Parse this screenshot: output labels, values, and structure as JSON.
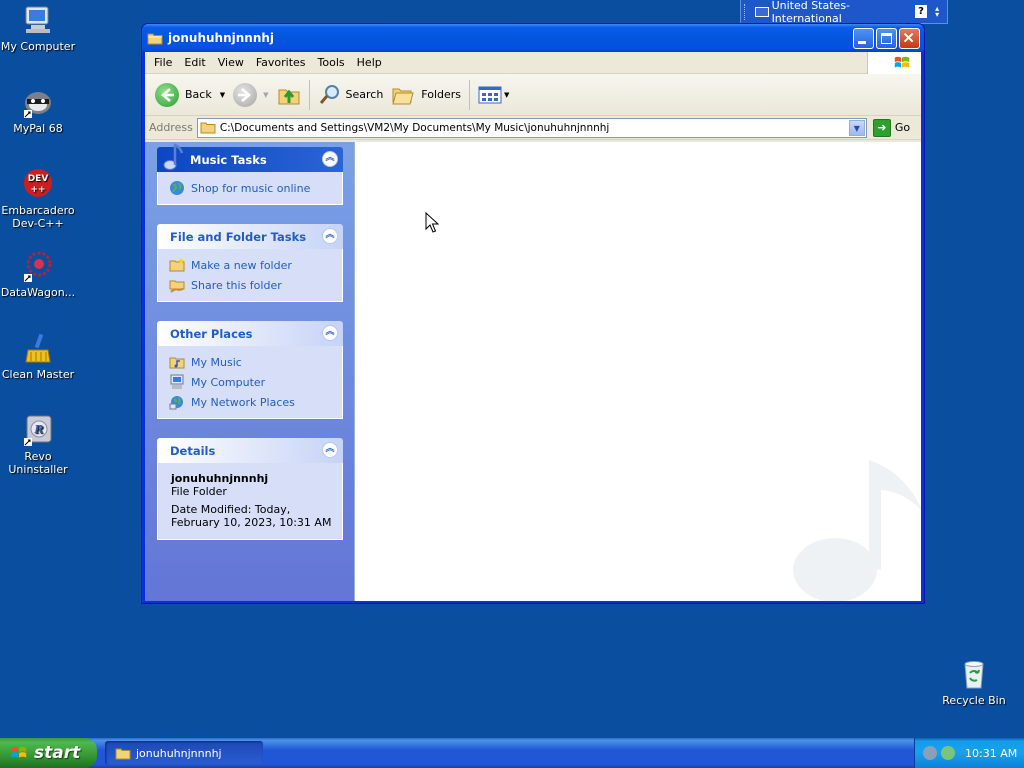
{
  "desktop": {
    "icons": [
      {
        "label": "My Computer"
      },
      {
        "label": "MyPal 68"
      },
      {
        "label": "Embarcadero Dev-C++"
      },
      {
        "label": "DataWagon..."
      },
      {
        "label": "Clean Master"
      },
      {
        "label": "Revo Uninstaller"
      },
      {
        "label": "Recycle Bin"
      }
    ]
  },
  "langbar": {
    "language": "United States-International",
    "help": "?"
  },
  "window": {
    "title": "jonuhuhnjnnnhj",
    "menu": [
      "File",
      "Edit",
      "View",
      "Favorites",
      "Tools",
      "Help"
    ],
    "toolbar": {
      "back": "Back",
      "search": "Search",
      "folders": "Folders"
    },
    "address": {
      "label": "Address",
      "path": "C:\\Documents and Settings\\VM2\\My Documents\\My Music\\jonuhuhnjnnnhj",
      "go": "Go"
    },
    "taskpane": {
      "music_tasks": {
        "title": "Music Tasks",
        "items": [
          "Shop for music online"
        ]
      },
      "file_folder_tasks": {
        "title": "File and Folder Tasks",
        "items": [
          "Make a new folder",
          "Share this folder"
        ]
      },
      "other_places": {
        "title": "Other Places",
        "items": [
          "My Music",
          "My Computer",
          "My Network Places"
        ]
      },
      "details": {
        "title": "Details",
        "name": "jonuhuhnjnnnhj",
        "type": "File Folder",
        "modified": "Date Modified: Today, February 10, 2023, 10:31 AM"
      }
    }
  },
  "taskbar": {
    "start": "start",
    "task": "jonuhuhnjnnnhj",
    "clock": "10:31 AM"
  }
}
